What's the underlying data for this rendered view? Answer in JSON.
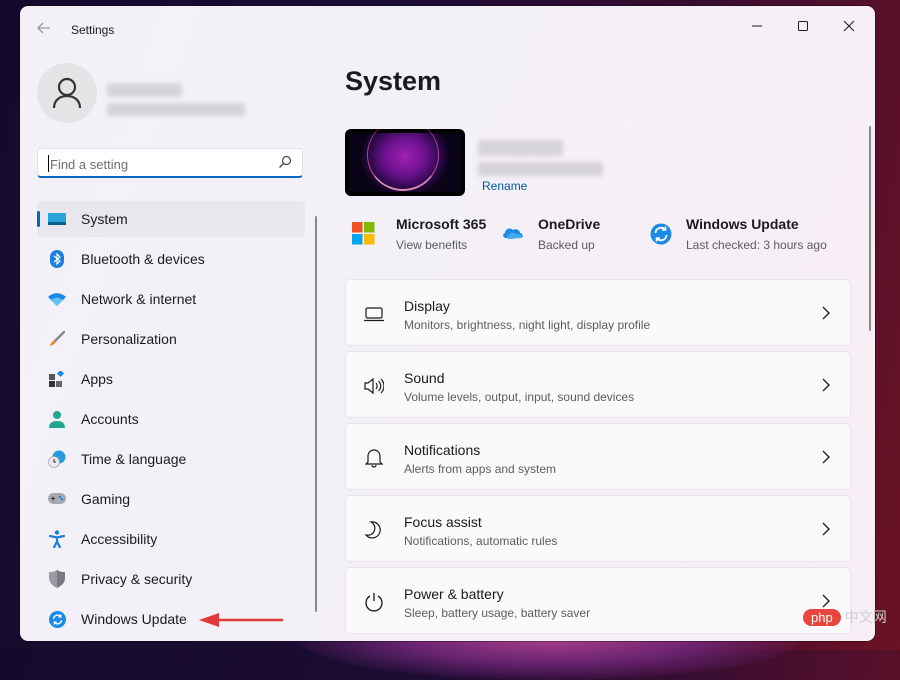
{
  "window": {
    "title": "Settings",
    "controls": {
      "minimize": "minimize",
      "maximize": "maximize",
      "close": "close"
    }
  },
  "profile": {
    "name": "[blurred]",
    "email": "[blurred]"
  },
  "search": {
    "placeholder": "Find a setting",
    "value": ""
  },
  "sidebar": {
    "items": [
      {
        "label": "System",
        "icon": "system-icon",
        "active": true
      },
      {
        "label": "Bluetooth & devices",
        "icon": "bluetooth-icon"
      },
      {
        "label": "Network & internet",
        "icon": "wifi-icon"
      },
      {
        "label": "Personalization",
        "icon": "brush-icon"
      },
      {
        "label": "Apps",
        "icon": "apps-icon"
      },
      {
        "label": "Accounts",
        "icon": "person-icon"
      },
      {
        "label": "Time & language",
        "icon": "globe-clock-icon"
      },
      {
        "label": "Gaming",
        "icon": "gamepad-icon"
      },
      {
        "label": "Accessibility",
        "icon": "accessibility-icon"
      },
      {
        "label": "Privacy & security",
        "icon": "shield-icon"
      },
      {
        "label": "Windows Update",
        "icon": "windows-update-icon"
      }
    ]
  },
  "main": {
    "title": "System",
    "device": {
      "name": "[blurred]",
      "model": "[blurred]",
      "rename_label": "Rename"
    },
    "tiles": [
      {
        "title": "Microsoft 365",
        "subtitle": "View benefits",
        "icon": "microsoft-logo-icon"
      },
      {
        "title": "OneDrive",
        "subtitle": "Backed up",
        "icon": "onedrive-cloud-icon"
      },
      {
        "title": "Windows Update",
        "subtitle": "Last checked: 3 hours ago",
        "icon": "windows-update-icon"
      }
    ],
    "cards": [
      {
        "title": "Display",
        "subtitle": "Monitors, brightness, night light, display profile",
        "icon": "monitor-icon"
      },
      {
        "title": "Sound",
        "subtitle": "Volume levels, output, input, sound devices",
        "icon": "speaker-icon"
      },
      {
        "title": "Notifications",
        "subtitle": "Alerts from apps and system",
        "icon": "bell-icon"
      },
      {
        "title": "Focus assist",
        "subtitle": "Notifications, automatic rules",
        "icon": "moon-icon"
      },
      {
        "title": "Power & battery",
        "subtitle": "Sleep, battery usage, battery saver",
        "icon": "power-icon"
      }
    ]
  },
  "annotation": {
    "arrow_color": "#e03a3a",
    "points_to": "Windows Update"
  },
  "watermark": {
    "pill": "php",
    "text": "中文网"
  },
  "colors": {
    "accent": "#0067c0",
    "link": "#005a9e"
  }
}
